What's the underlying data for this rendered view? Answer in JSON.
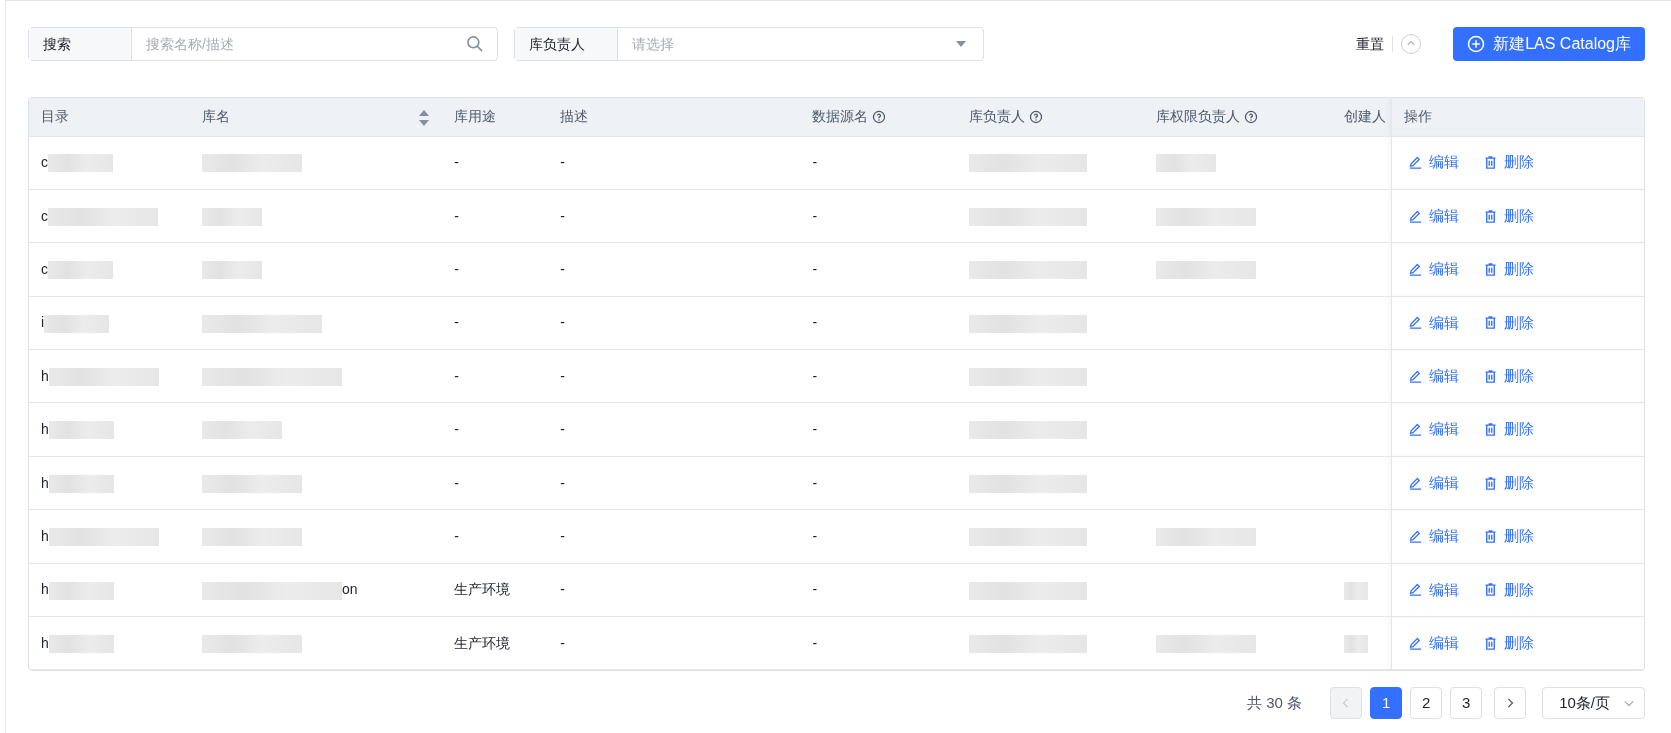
{
  "filters": [
    {
      "kind": "search",
      "label": "搜索",
      "placeholder": "搜索名称/描述"
    },
    {
      "kind": "select",
      "label": "库负责人",
      "placeholder": "请选择"
    }
  ],
  "toolbar": {
    "reset": "重置",
    "create": "新建LAS Catalog库"
  },
  "table": {
    "columns": [
      {
        "label": "目录",
        "kind": "plain"
      },
      {
        "label": "库名",
        "kind": "sortable"
      },
      {
        "label": "库用途",
        "kind": "plain"
      },
      {
        "label": "描述",
        "kind": "plain"
      },
      {
        "label": "数据源名",
        "kind": "help"
      },
      {
        "label": "库负责人",
        "kind": "help"
      },
      {
        "label": "库权限负责人",
        "kind": "help"
      },
      {
        "label": "创建人",
        "kind": "plain"
      },
      {
        "label": "操作",
        "kind": "fixed"
      }
    ],
    "rows": [
      {
        "catalog": "c",
        "purpose": "-",
        "description": "-",
        "datasource": "-",
        "actions": [
          "编辑",
          "删除"
        ]
      },
      {
        "catalog": "c",
        "purpose": "-",
        "description": "-",
        "datasource": "-",
        "actions": [
          "编辑",
          "删除"
        ]
      },
      {
        "catalog": "c",
        "purpose": "-",
        "description": "-",
        "datasource": "-",
        "actions": [
          "编辑",
          "删除"
        ]
      },
      {
        "catalog": "i",
        "purpose": "-",
        "description": "-",
        "datasource": "-",
        "actions": [
          "编辑",
          "删除"
        ]
      },
      {
        "catalog": "h",
        "purpose": "-",
        "description": "-",
        "datasource": "-",
        "actions": [
          "编辑",
          "删除"
        ]
      },
      {
        "catalog": "h",
        "purpose": "-",
        "description": "-",
        "datasource": "-",
        "actions": [
          "编辑",
          "删除"
        ]
      },
      {
        "catalog": "h",
        "purpose": "-",
        "description": "-",
        "datasource": "-",
        "actions": [
          "编辑",
          "删除"
        ]
      },
      {
        "catalog": "h",
        "purpose": "-",
        "description": "-",
        "datasource": "-",
        "actions": [
          "编辑",
          "删除"
        ]
      },
      {
        "catalog": "h",
        "name": "on",
        "purpose": "生产环境",
        "description": "-",
        "datasource": "-",
        "actions": [
          "编辑",
          "删除"
        ]
      },
      {
        "catalog": "h",
        "purpose": "生产环境",
        "description": "-",
        "datasource": "-",
        "actions": [
          "编辑",
          "删除"
        ]
      }
    ]
  },
  "pagination": {
    "total": "共 30 条",
    "prev": {
      "disabled": true
    },
    "next": {
      "disabled": false
    },
    "pages": [
      {
        "label": "1",
        "selected": true
      },
      {
        "label": "2",
        "selected": false
      },
      {
        "label": "3",
        "selected": false
      }
    ],
    "page_size": "10条/页"
  }
}
